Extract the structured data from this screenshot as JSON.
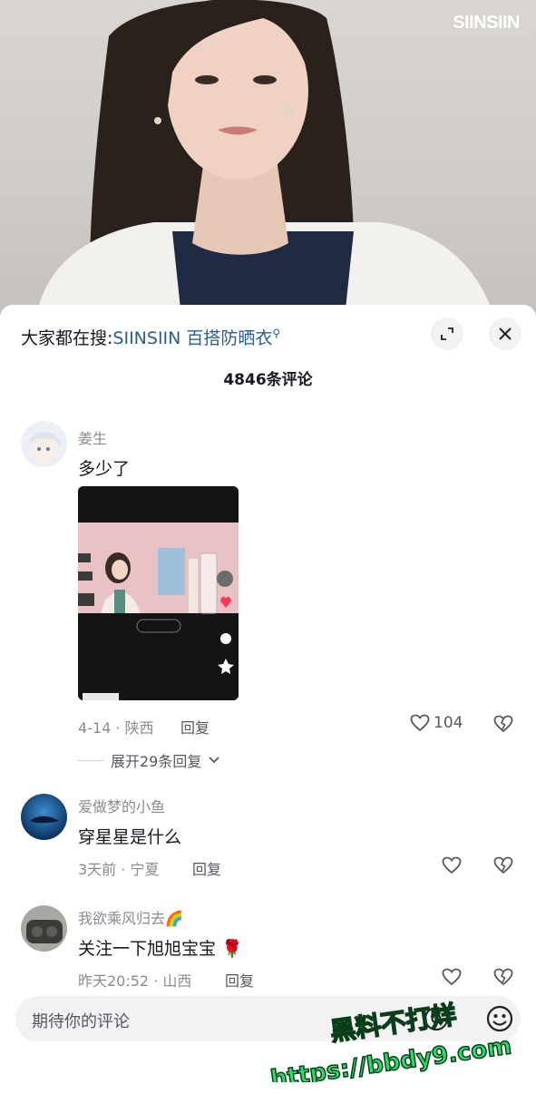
{
  "video": {
    "brand_logo": "SIINSIIN"
  },
  "sheet": {
    "search_prefix": "大家都在搜:",
    "search_keyword": "SIINSIIN 百搭防晒衣",
    "comment_count": "4846条评论"
  },
  "comments": [
    {
      "name": "姜生",
      "text": "多少了",
      "date": "4-14 · 陕西",
      "reply_label": "回复",
      "likes": "104",
      "expand_replies": "展开29条回复"
    },
    {
      "name": "爱做梦的小鱼",
      "text": "穿星星是什么",
      "date": "3天前 · 宁夏",
      "reply_label": "回复"
    },
    {
      "name": "我欲乘风归去🌈",
      "text": "关注一下旭旭宝宝 🌹",
      "date": "昨天20:52 · 山西",
      "reply_label": "回复"
    }
  ],
  "input": {
    "placeholder": "期待你的评论"
  },
  "watermark": {
    "line1": "黑料不打烊",
    "line2": "https://bbdy9.com"
  }
}
